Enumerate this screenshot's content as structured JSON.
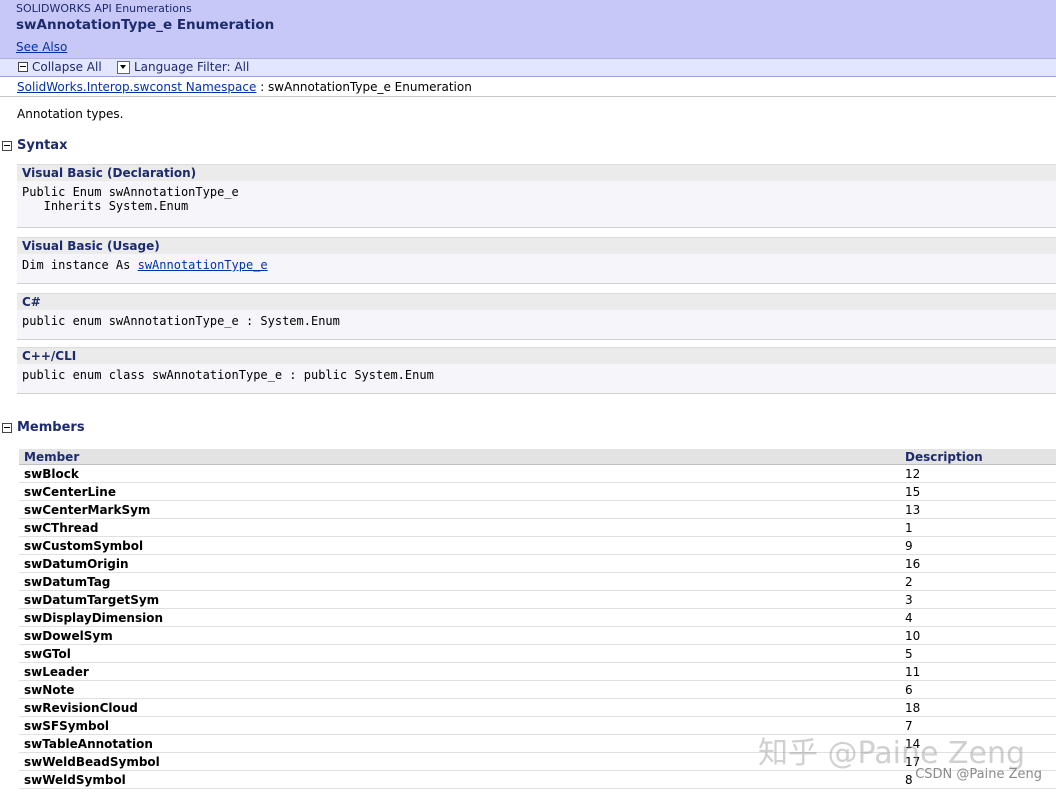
{
  "header": {
    "product": "SOLIDWORKS API Enumerations",
    "title": "swAnnotationType_e Enumeration",
    "see_also": "See Also"
  },
  "toolbar": {
    "collapse_all": "Collapse All",
    "language_filter": "Language Filter: All"
  },
  "breadcrumb": {
    "namespace_link": "SolidWorks.Interop.swconst Namespace",
    "current": " : swAnnotationType_e Enumeration"
  },
  "summary": "Annotation types.",
  "syntax": {
    "heading": "Syntax",
    "blocks": [
      {
        "lang": "Visual Basic (Declaration)",
        "line1": "Public Enum swAnnotationType_e",
        "line2": "   Inherits System.Enum"
      },
      {
        "lang": "Visual Basic (Usage)",
        "prefix": "Dim instance As ",
        "link": "swAnnotationType_e"
      },
      {
        "lang": "C#",
        "line1": "public enum swAnnotationType_e : System.Enum"
      },
      {
        "lang": "C++/CLI",
        "line1": "public enum class swAnnotationType_e : public System.Enum"
      }
    ]
  },
  "members": {
    "heading": "Members",
    "columns": [
      "Member",
      "Description"
    ],
    "rows": [
      [
        "swBlock",
        "12"
      ],
      [
        "swCenterLine",
        "15"
      ],
      [
        "swCenterMarkSym",
        "13"
      ],
      [
        "swCThread",
        "1"
      ],
      [
        "swCustomSymbol",
        "9"
      ],
      [
        "swDatumOrigin",
        "16"
      ],
      [
        "swDatumTag",
        "2"
      ],
      [
        "swDatumTargetSym",
        "3"
      ],
      [
        "swDisplayDimension",
        "4"
      ],
      [
        "swDowelSym",
        "10"
      ],
      [
        "swGTol",
        "5"
      ],
      [
        "swLeader",
        "11"
      ],
      [
        "swNote",
        "6"
      ],
      [
        "swRevisionCloud",
        "18"
      ],
      [
        "swSFSymbol",
        "7"
      ],
      [
        "swTableAnnotation",
        "14"
      ],
      [
        "swWeldBeadSymbol",
        "17"
      ],
      [
        "swWeldSymbol",
        "8"
      ]
    ]
  },
  "watermark": "知乎 @Paine Zeng",
  "credit": "CSDN @Paine Zeng"
}
